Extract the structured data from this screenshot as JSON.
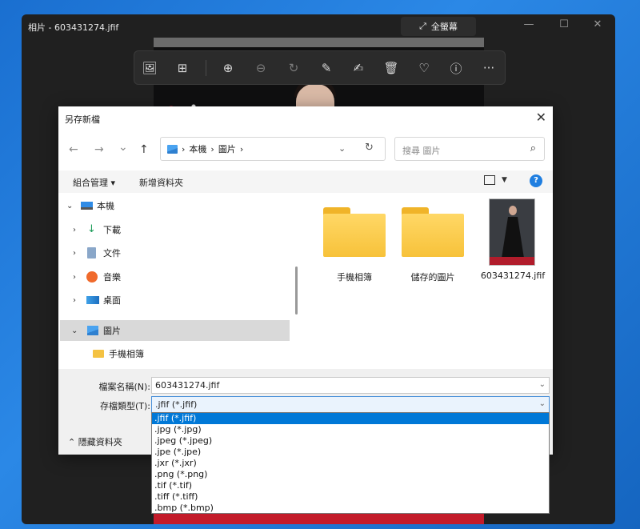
{
  "photos_app": {
    "title": "相片 - 603431274.jfif",
    "fullscreen_label": "全螢幕",
    "fullscreen_icon": "⤢",
    "window_controls": {
      "minimize": "—",
      "maximize": "☐",
      "close": "✕"
    },
    "toolbar_icons": {
      "gallery": "🖼",
      "filmstrip": "⊞",
      "zoom_in": "⊕",
      "zoom_out": "⊖",
      "rotate": "↻",
      "edit": "✎",
      "draw": "✍",
      "delete": "🗑",
      "favorite": "♡",
      "info": "ⓘ",
      "more": "···"
    }
  },
  "dialog": {
    "title": "另存新檔",
    "close": "✕",
    "nav": {
      "back": "←",
      "forward": "→",
      "recent": "⌄",
      "up": "↑"
    },
    "breadcrumb": [
      "本機",
      "圖片"
    ],
    "breadcrumb_sep": "›",
    "address_dropdown": "⌄",
    "refresh": "↻",
    "search_placeholder": "搜尋 圖片",
    "search_icon": "⌕",
    "organize_label": "組合管理 ▾",
    "new_folder_label": "新增資料夾",
    "view_dropdown": "▼",
    "help": "?",
    "tree": [
      {
        "label": "本機",
        "chevron": "⌄",
        "icon": "computer-icon"
      },
      {
        "label": "下載",
        "chevron": "›",
        "icon": "download-icon"
      },
      {
        "label": "文件",
        "chevron": "›",
        "icon": "documents-icon"
      },
      {
        "label": "音樂",
        "chevron": "›",
        "icon": "music-icon"
      },
      {
        "label": "桌面",
        "chevron": "›",
        "icon": "desktop-icon"
      },
      {
        "label": "圖片",
        "chevron": "⌄",
        "icon": "pictures-icon"
      },
      {
        "label": "手機相簿",
        "chevron": "",
        "icon": "folder-icon"
      }
    ],
    "files": [
      {
        "name": "手機相簿",
        "type": "folder"
      },
      {
        "name": "儲存的圖片",
        "type": "folder"
      },
      {
        "name": "603431274.jfif",
        "type": "image"
      }
    ],
    "filename_label": "檔案名稱(N):",
    "filename_value": "603431274.jfif",
    "filetype_label": "存檔類型(T):",
    "filetype_value": ".jfif (*.jfif)",
    "field_chevron": "⌄",
    "hide_folders_label": "⌃  隱藏資料夾",
    "filetype_options": [
      ".jfif (*.jfif)",
      ".jpg (*.jpg)",
      ".jpeg (*.jpeg)",
      ".jpe (*.jpe)",
      ".jxr (*.jxr)",
      ".png (*.png)",
      ".tif (*.tif)",
      ".tiff (*.tiff)",
      ".bmp (*.bmp)"
    ]
  }
}
